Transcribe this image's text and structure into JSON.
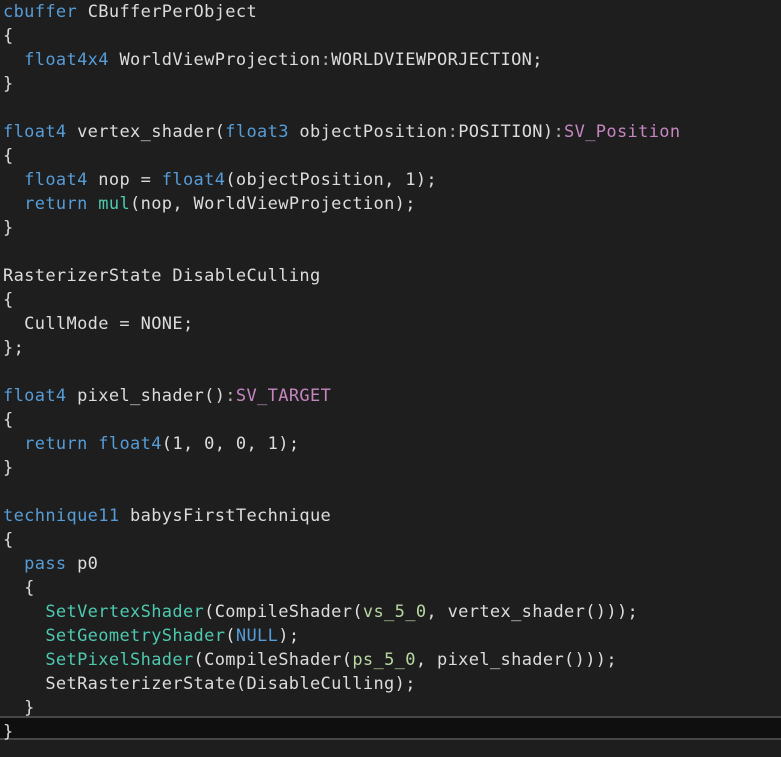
{
  "editor": {
    "language": "HLSL",
    "colors": {
      "background": "#1e1e1e",
      "current_line": "#0f0f0f",
      "keyword": "#569cd6",
      "type": "#4ec9b0",
      "plain": "#dcdcdc",
      "semantic": "#c586c0",
      "shader_profile": "#b8d7a3"
    },
    "lines": [
      [
        {
          "t": "cbuffer",
          "c": "kw"
        },
        {
          "t": " CBufferPerObject",
          "c": "plain"
        }
      ],
      [
        {
          "t": "{",
          "c": "plain"
        }
      ],
      [
        {
          "t": "  ",
          "c": "plain"
        },
        {
          "t": "float4x4",
          "c": "kw"
        },
        {
          "t": " WorldViewProjection",
          "c": "plain"
        },
        {
          "t": ":",
          "c": "punct"
        },
        {
          "t": "WORLDVIEWPORJECTION;",
          "c": "plain"
        }
      ],
      [
        {
          "t": "}",
          "c": "plain"
        }
      ],
      [],
      [
        {
          "t": "float4",
          "c": "kw"
        },
        {
          "t": " vertex_shader(",
          "c": "plain"
        },
        {
          "t": "float3",
          "c": "kw"
        },
        {
          "t": " objectPosition",
          "c": "plain"
        },
        {
          "t": ":",
          "c": "punct"
        },
        {
          "t": "POSITION)",
          "c": "plain"
        },
        {
          "t": ":",
          "c": "punct"
        },
        {
          "t": "SV_Position",
          "c": "sv"
        }
      ],
      [
        {
          "t": "{",
          "c": "plain"
        }
      ],
      [
        {
          "t": "  ",
          "c": "plain"
        },
        {
          "t": "float4",
          "c": "kw"
        },
        {
          "t": " nop = ",
          "c": "plain"
        },
        {
          "t": "float4",
          "c": "kw"
        },
        {
          "t": "(objectPosition, 1);",
          "c": "plain"
        }
      ],
      [
        {
          "t": "  ",
          "c": "plain"
        },
        {
          "t": "return",
          "c": "kw"
        },
        {
          "t": " ",
          "c": "plain"
        },
        {
          "t": "mul",
          "c": "type"
        },
        {
          "t": "(nop, WorldViewProjection);",
          "c": "plain"
        }
      ],
      [
        {
          "t": "}",
          "c": "plain"
        }
      ],
      [],
      [
        {
          "t": "RasterizerState DisableCulling",
          "c": "plain"
        }
      ],
      [
        {
          "t": "{",
          "c": "plain"
        }
      ],
      [
        {
          "t": "  CullMode = NONE;",
          "c": "plain"
        }
      ],
      [
        {
          "t": "};",
          "c": "plain"
        }
      ],
      [],
      [
        {
          "t": "float4",
          "c": "kw"
        },
        {
          "t": " pixel_shader()",
          "c": "plain"
        },
        {
          "t": ":",
          "c": "punct"
        },
        {
          "t": "SV_TARGET",
          "c": "sv"
        }
      ],
      [
        {
          "t": "{",
          "c": "plain"
        }
      ],
      [
        {
          "t": "  ",
          "c": "plain"
        },
        {
          "t": "return",
          "c": "kw"
        },
        {
          "t": " ",
          "c": "plain"
        },
        {
          "t": "float4",
          "c": "kw"
        },
        {
          "t": "(1, 0, 0, 1);",
          "c": "plain"
        }
      ],
      [
        {
          "t": "}",
          "c": "plain"
        }
      ],
      [],
      [
        {
          "t": "technique11",
          "c": "kw"
        },
        {
          "t": " babysFirstTechnique",
          "c": "plain"
        }
      ],
      [
        {
          "t": "{",
          "c": "plain"
        }
      ],
      [
        {
          "t": "  ",
          "c": "plain"
        },
        {
          "t": "pass",
          "c": "kw"
        },
        {
          "t": " p0",
          "c": "plain"
        }
      ],
      [
        {
          "t": "  {",
          "c": "plain"
        }
      ],
      [
        {
          "t": "    ",
          "c": "plain"
        },
        {
          "t": "SetVertexShader",
          "c": "type"
        },
        {
          "t": "(CompileShader(",
          "c": "plain"
        },
        {
          "t": "vs_5_0",
          "c": "sem"
        },
        {
          "t": ", vertex_shader()));",
          "c": "plain"
        }
      ],
      [
        {
          "t": "    ",
          "c": "plain"
        },
        {
          "t": "SetGeometryShader",
          "c": "type"
        },
        {
          "t": "(",
          "c": "plain"
        },
        {
          "t": "NULL",
          "c": "kw"
        },
        {
          "t": ");",
          "c": "plain"
        }
      ],
      [
        {
          "t": "    ",
          "c": "plain"
        },
        {
          "t": "SetPixelShader",
          "c": "type"
        },
        {
          "t": "(CompileShader(",
          "c": "plain"
        },
        {
          "t": "ps_5_0",
          "c": "sem"
        },
        {
          "t": ", pixel_shader()));",
          "c": "plain"
        }
      ],
      [
        {
          "t": "    SetRasterizerState(DisableCulling);",
          "c": "plain"
        }
      ],
      [
        {
          "t": "  }",
          "c": "plain"
        }
      ],
      [
        {
          "t": "}",
          "c": "plain"
        }
      ]
    ]
  }
}
